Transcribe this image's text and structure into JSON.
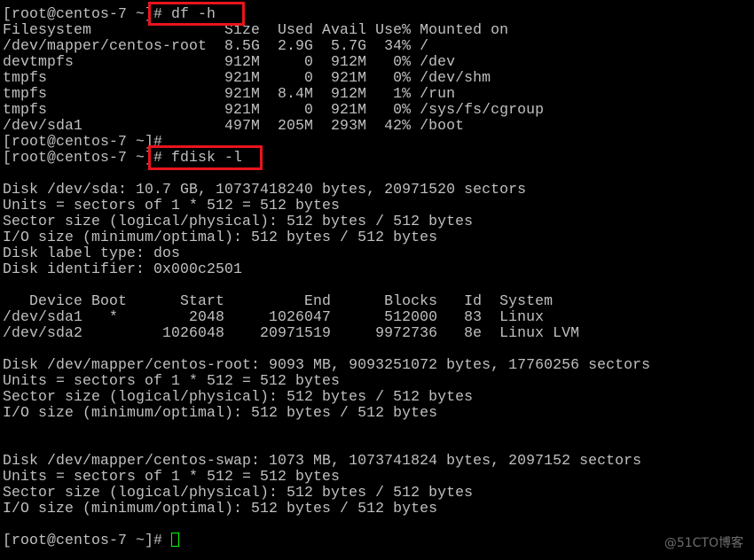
{
  "terminal": {
    "prompt": "[root@centos-7 ~]# ",
    "commands": [
      "df -h",
      "fdisk -l"
    ],
    "lines": [
      "[root@centos-7 ~]# df -h",
      "Filesystem               Size  Used Avail Use% Mounted on",
      "/dev/mapper/centos-root  8.5G  2.9G  5.7G  34% /",
      "devtmpfs                 912M     0  912M   0% /dev",
      "tmpfs                    921M     0  921M   0% /dev/shm",
      "tmpfs                    921M  8.4M  912M   1% /run",
      "tmpfs                    921M     0  921M   0% /sys/fs/cgroup",
      "/dev/sda1                497M  205M  293M  42% /boot",
      "[root@centos-7 ~]#",
      "[root@centos-7 ~]# fdisk -l",
      "",
      "Disk /dev/sda: 10.7 GB, 10737418240 bytes, 20971520 sectors",
      "Units = sectors of 1 * 512 = 512 bytes",
      "Sector size (logical/physical): 512 bytes / 512 bytes",
      "I/O size (minimum/optimal): 512 bytes / 512 bytes",
      "Disk label type: dos",
      "Disk identifier: 0x000c2501",
      "",
      "   Device Boot      Start         End      Blocks   Id  System",
      "/dev/sda1   *        2048     1026047      512000   83  Linux",
      "/dev/sda2         1026048    20971519     9972736   8e  Linux LVM",
      "",
      "Disk /dev/mapper/centos-root: 9093 MB, 9093251072 bytes, 17760256 sectors",
      "Units = sectors of 1 * 512 = 512 bytes",
      "Sector size (logical/physical): 512 bytes / 512 bytes",
      "I/O size (minimum/optimal): 512 bytes / 512 bytes",
      "",
      "",
      "Disk /dev/mapper/centos-swap: 1073 MB, 1073741824 bytes, 2097152 sectors",
      "Units = sectors of 1 * 512 = 512 bytes",
      "Sector size (logical/physical): 512 bytes / 512 bytes",
      "I/O size (minimum/optimal): 512 bytes / 512 bytes",
      "",
      "[root@centos-7 ~]# "
    ]
  },
  "df_output": {
    "headers": [
      "Filesystem",
      "Size",
      "Used",
      "Avail",
      "Use%",
      "Mounted on"
    ],
    "rows": [
      [
        "/dev/mapper/centos-root",
        "8.5G",
        "2.9G",
        "5.7G",
        "34%",
        "/"
      ],
      [
        "devtmpfs",
        "912M",
        "0",
        "912M",
        "0%",
        "/dev"
      ],
      [
        "tmpfs",
        "921M",
        "0",
        "921M",
        "0%",
        "/dev/shm"
      ],
      [
        "tmpfs",
        "921M",
        "8.4M",
        "912M",
        "1%",
        "/run"
      ],
      [
        "tmpfs",
        "921M",
        "0",
        "921M",
        "0%",
        "/sys/fs/cgroup"
      ],
      [
        "/dev/sda1",
        "497M",
        "205M",
        "293M",
        "42%",
        "/boot"
      ]
    ]
  },
  "partition_table": {
    "headers": [
      "Device",
      "Boot",
      "Start",
      "End",
      "Blocks",
      "Id",
      "System"
    ],
    "rows": [
      [
        "/dev/sda1",
        "*",
        "2048",
        "1026047",
        "512000",
        "83",
        "Linux"
      ],
      [
        "/dev/sda2",
        "",
        "1026048",
        "20971519",
        "9972736",
        "8e",
        "Linux LVM"
      ]
    ]
  },
  "colors": {
    "text": "#c0c0c0",
    "background": "#000000",
    "highlight_box": "#e8141d",
    "cursor": "#00ff00"
  },
  "watermark": "@51CTO博客"
}
